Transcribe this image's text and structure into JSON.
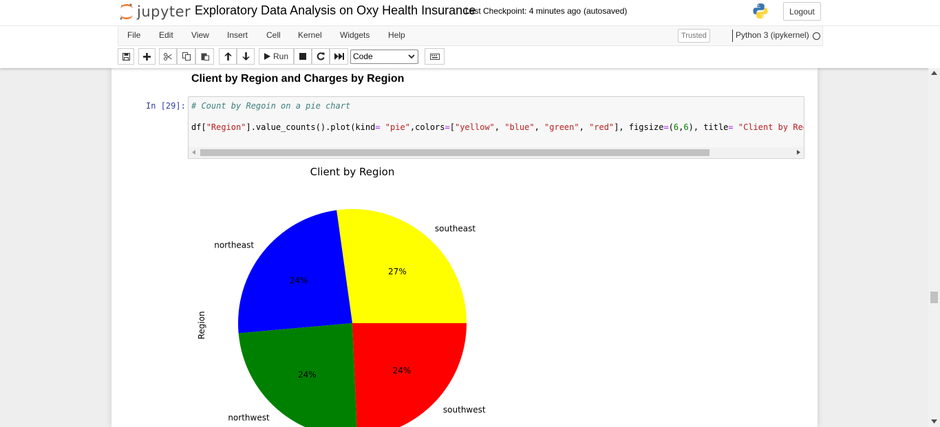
{
  "header": {
    "logo_text": "jupyter",
    "notebook_name": "Exploratory Data Analysis on Oxy Health Insurance",
    "checkpoint": "Last Checkpoint: 4 minutes ago",
    "autosave": "(autosaved)",
    "logout_label": "Logout"
  },
  "menubar": {
    "items": [
      "File",
      "Edit",
      "View",
      "Insert",
      "Cell",
      "Kernel",
      "Widgets",
      "Help"
    ],
    "trusted_label": "Trusted",
    "kernel_name": "Python 3 (ipykernel)"
  },
  "toolbar": {
    "run_label": "Run",
    "cell_type": "Code",
    "icons": [
      "save-icon",
      "plus-icon",
      "cut-icon",
      "copy-icon",
      "paste-icon",
      "arrow-up-icon",
      "arrow-down-icon",
      "run-icon",
      "stop-icon",
      "restart-icon",
      "fast-forward-icon",
      "keyboard-icon"
    ]
  },
  "notebook": {
    "markdown_heading": "Client by Region and Charges by Region",
    "prompt": "In [29]:",
    "code_comment": "# Count by Regoin on a pie chart",
    "code_tokens": [
      {
        "t": "df[",
        "c": ""
      },
      {
        "t": "\"Region\"",
        "c": "s"
      },
      {
        "t": "].value_counts().plot(kind",
        "c": ""
      },
      {
        "t": "=",
        "c": "o"
      },
      {
        "t": " ",
        "c": ""
      },
      {
        "t": "\"pie\"",
        "c": "s"
      },
      {
        "t": ",colors",
        "c": ""
      },
      {
        "t": "=",
        "c": "o"
      },
      {
        "t": "[",
        "c": ""
      },
      {
        "t": "\"yellow\"",
        "c": "s"
      },
      {
        "t": ", ",
        "c": ""
      },
      {
        "t": "\"blue\"",
        "c": "s"
      },
      {
        "t": ", ",
        "c": ""
      },
      {
        "t": "\"green\"",
        "c": "s"
      },
      {
        "t": ", ",
        "c": ""
      },
      {
        "t": "\"red\"",
        "c": "s"
      },
      {
        "t": "], figsize",
        "c": ""
      },
      {
        "t": "=",
        "c": "o"
      },
      {
        "t": "(",
        "c": ""
      },
      {
        "t": "6",
        "c": "n"
      },
      {
        "t": ",",
        "c": ""
      },
      {
        "t": "6",
        "c": "n"
      },
      {
        "t": "), title",
        "c": ""
      },
      {
        "t": "=",
        "c": "o"
      },
      {
        "t": " ",
        "c": ""
      },
      {
        "t": "\"Client by Region\"",
        "c": "s"
      },
      {
        "t": ",",
        "c": ""
      }
    ]
  },
  "chart_data": {
    "type": "pie",
    "title": "Client by Region",
    "ylabel": "Region",
    "slices": [
      {
        "label": "southeast",
        "pct_label": "27%",
        "value": 27.2,
        "color": "#ffff00"
      },
      {
        "label": "northeast",
        "pct_label": "24%",
        "value": 24.2,
        "color": "#0000ff"
      },
      {
        "label": "northwest",
        "pct_label": "24%",
        "value": 24.3,
        "color": "#008000"
      },
      {
        "label": "southwest",
        "pct_label": "24%",
        "value": 24.3,
        "color": "#ff0000"
      }
    ],
    "startangle_deg": 0,
    "counterclockwise": true
  },
  "colors": {
    "prompt": "#303f9f",
    "string": "#ba2121",
    "operator": "#aa22ff",
    "number": "#008000",
    "comment": "#408080"
  }
}
